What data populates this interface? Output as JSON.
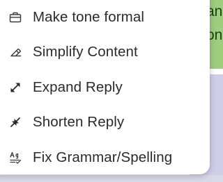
{
  "background": {
    "green_panel_text": "an\non",
    "colors": {
      "green_panel": "#9fce7e",
      "lavender_panel": "#cfcde8"
    }
  },
  "menu": {
    "items": [
      {
        "label": "Make tone formal",
        "icon": "briefcase-icon"
      },
      {
        "label": "Simplify Content",
        "icon": "eraser-icon"
      },
      {
        "label": "Expand Reply",
        "icon": "expand-arrows-icon"
      },
      {
        "label": "Shorten Reply",
        "icon": "shrink-arrows-icon"
      },
      {
        "label": "Fix Grammar/Spelling",
        "icon": "spell-check-icon"
      }
    ]
  }
}
